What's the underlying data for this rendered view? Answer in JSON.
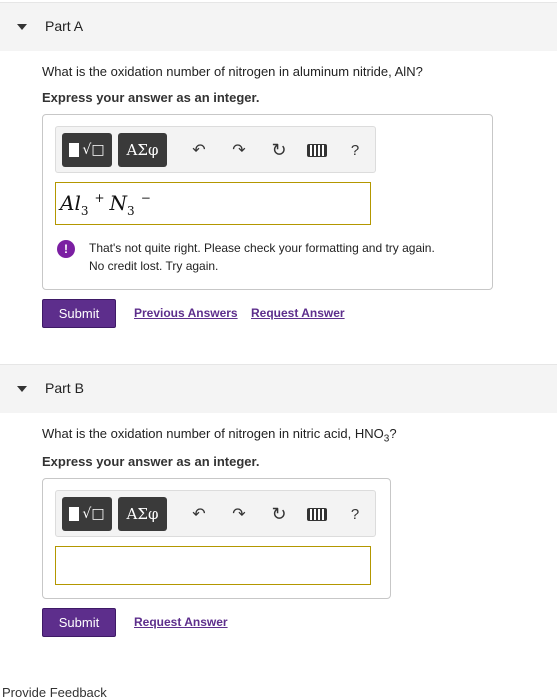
{
  "partA": {
    "title": "Part A",
    "question": "What is the oxidation number of nitrogen in aluminum nitride, AlN?",
    "instruction": "Express your answer as an integer.",
    "toolbar": {
      "template_label": "√□",
      "greek_label": "ΑΣφ",
      "help_label": "?"
    },
    "answer": {
      "al": "Al",
      "al_sub": "3",
      "plus": "+",
      "n": "N",
      "n_sub": "3",
      "minus": "−"
    },
    "feedback": {
      "icon": "!",
      "line1": "That's not quite right. Please check your formatting and try again.",
      "line2": "No credit lost. Try again."
    },
    "submit_label": "Submit",
    "previous_answers_label": "Previous Answers",
    "request_answer_label": "Request Answer"
  },
  "partB": {
    "title": "Part B",
    "question_prefix": "What is the oxidation number of nitrogen in nitric acid, HNO",
    "question_sub": "3",
    "question_suffix": "?",
    "instruction": "Express your answer as an integer.",
    "toolbar": {
      "template_label": "√□",
      "greek_label": "ΑΣφ",
      "help_label": "?"
    },
    "answer_value": "",
    "submit_label": "Submit",
    "request_answer_label": "Request Answer"
  },
  "footer": {
    "provide_feedback": "Provide Feedback"
  },
  "colors": {
    "submit": "#5d2e8c",
    "warn": "#7b1fa2",
    "input_border": "#b39700"
  },
  "icons": [
    "chevron-down-icon",
    "undo-icon",
    "redo-icon",
    "reset-icon",
    "keyboard-icon",
    "help-icon",
    "warning-icon"
  ]
}
